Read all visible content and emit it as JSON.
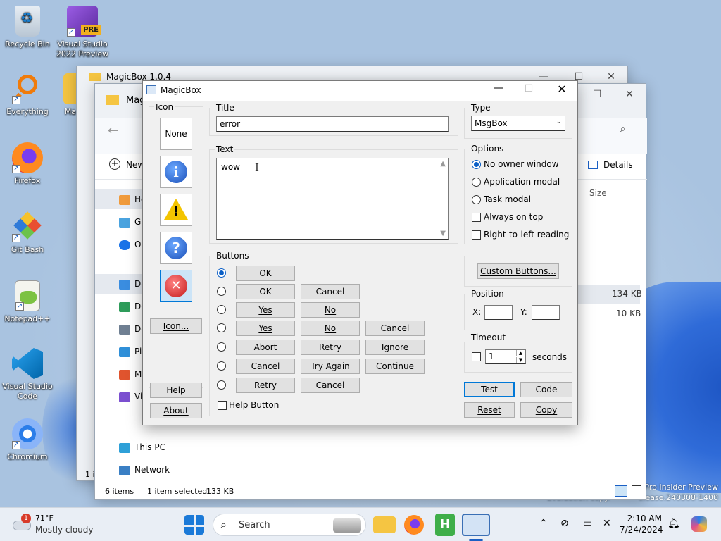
{
  "desktop": {
    "icons": [
      {
        "label": "Recycle Bin",
        "icon": "recycle-bin-icon"
      },
      {
        "label": "Visual Studio 2022 Preview",
        "badge": "PRE",
        "icon": "visual-studio-icon"
      },
      {
        "label": "Everything",
        "icon": "everything-icon"
      },
      {
        "label": "Ma",
        "icon": "folder-icon"
      },
      {
        "label": "Firefox",
        "icon": "firefox-icon"
      },
      {
        "label": "Git Bash",
        "icon": "git-bash-icon"
      },
      {
        "label": "Notepad++",
        "icon": "notepadpp-icon"
      },
      {
        "label": "Visual Studio Code",
        "icon": "vscode-icon"
      },
      {
        "label": "Chromium",
        "icon": "chromium-icon"
      }
    ],
    "watermark": {
      "line1": "Pro Insider Preview",
      "line2": "Evaluation copy.",
      "line3": "elease.240308-1400"
    }
  },
  "explorer_back": {
    "title": "MagicBox 1.0.4"
  },
  "explorer": {
    "title": "Mag",
    "new_label": "New",
    "details_label": "Details",
    "size_header": "Size",
    "sizes": [
      "134 KB",
      "10 KB"
    ],
    "nav": [
      "Ho",
      "Ga",
      "Or",
      "De",
      "Do",
      "Do",
      "Pic",
      "Mu",
      "Vic",
      "This PC",
      "Network"
    ],
    "status": {
      "items": "6 items",
      "selected": "1 item selected",
      "size": "133 KB",
      "left": "1 i"
    }
  },
  "dialog": {
    "title": "MagicBox",
    "icon_group": "Icon",
    "icon_none": "None",
    "icon_btn": "Icon...",
    "help": "Help",
    "about": "About",
    "title_label": "Title",
    "title_value": "error",
    "text_label": "Text",
    "text_value": "wow",
    "type_label": "Type",
    "type_value": "MsgBox",
    "options_label": "Options",
    "options": [
      "No owner window",
      "Application modal",
      "Task modal"
    ],
    "checks": [
      "Always on top",
      "Right-to-left reading"
    ],
    "buttons_label": "Buttons",
    "button_rows": [
      [
        "OK"
      ],
      [
        "OK",
        "Cancel"
      ],
      [
        "Yes",
        "No"
      ],
      [
        "Yes",
        "No",
        "Cancel"
      ],
      [
        "Abort",
        "Retry",
        "Ignore"
      ],
      [
        "Cancel",
        "Try Again",
        "Continue"
      ],
      [
        "Retry",
        "Cancel"
      ]
    ],
    "help_button": "Help Button",
    "custom_buttons": "Custom Buttons...",
    "position_label": "Position",
    "x_label": "X:",
    "y_label": "Y:",
    "timeout_label": "Timeout",
    "timeout_value": "1",
    "seconds": "seconds",
    "test": "Test",
    "code": "Code",
    "reset": "Reset",
    "copy": "Copy"
  },
  "taskbar": {
    "weather_temp": "71°F",
    "weather_desc": "Mostly cloudy",
    "weather_badge": "1",
    "search": "Search",
    "time": "2:10 AM",
    "date": "7/24/2024"
  }
}
